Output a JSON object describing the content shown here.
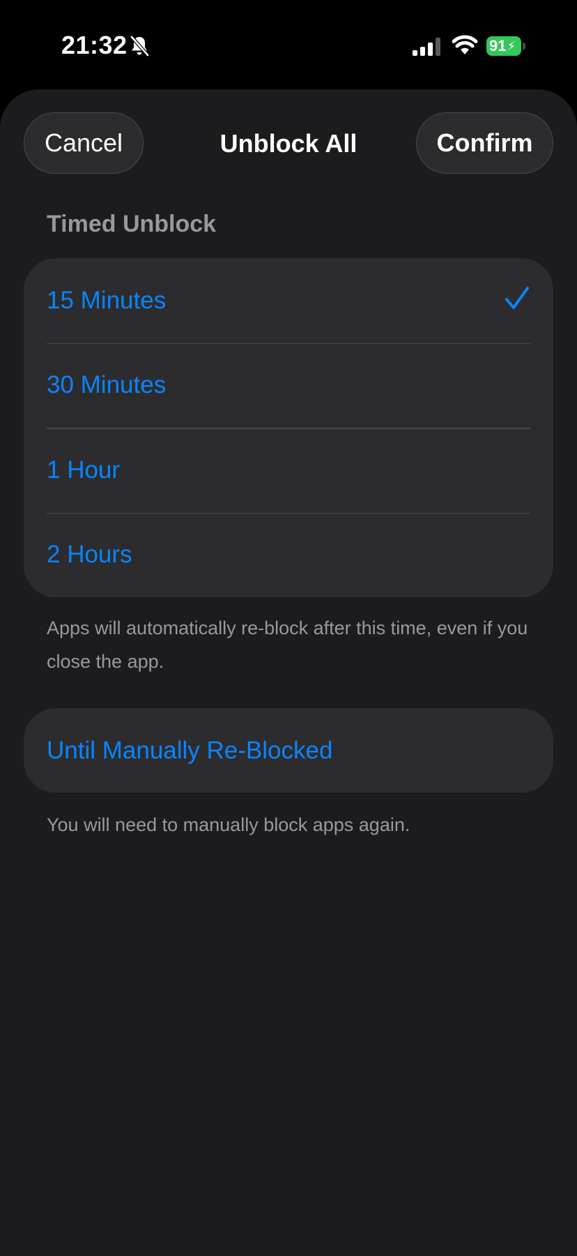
{
  "status_bar": {
    "time": "21:32",
    "battery_level": "91",
    "icons": [
      "bell-slash-icon",
      "cellular-signal-icon",
      "wifi-icon",
      "battery-charging-icon"
    ]
  },
  "sheet": {
    "cancel_label": "Cancel",
    "title": "Unblock All",
    "confirm_label": "Confirm"
  },
  "timed_unblock": {
    "header": "Timed Unblock",
    "options": [
      {
        "label": "15 Minutes",
        "selected": true
      },
      {
        "label": "30 Minutes",
        "selected": false
      },
      {
        "label": "1 Hour",
        "selected": false
      },
      {
        "label": "2 Hours",
        "selected": false
      }
    ],
    "footnote": "Apps will automatically re-block after this time, even if you close the app."
  },
  "manual": {
    "label": "Until Manually Re-Blocked",
    "footnote": "You will need to manually block apps again."
  },
  "colors": {
    "accent": "#0a84ff",
    "sheet_background": "#1c1c1e",
    "group_background": "#2c2c2e",
    "secondary_text": "#98989f",
    "battery": "#34c759"
  }
}
